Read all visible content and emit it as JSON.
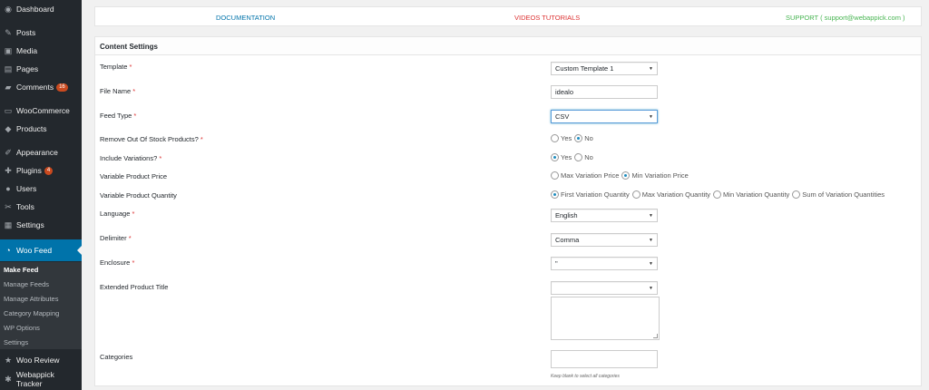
{
  "sidebar": {
    "items": [
      {
        "label": "Dashboard",
        "icon": "dashboard-icon",
        "glyph": "◉"
      },
      {
        "label": "Posts",
        "icon": "pin-icon",
        "glyph": "✎"
      },
      {
        "label": "Media",
        "icon": "media-icon",
        "glyph": "▣"
      },
      {
        "label": "Pages",
        "icon": "pages-icon",
        "glyph": "▤"
      },
      {
        "label": "Comments",
        "icon": "comments-icon",
        "glyph": "▰",
        "badge": "16"
      },
      {
        "label": "WooCommerce",
        "icon": "woocommerce-icon",
        "glyph": "▭"
      },
      {
        "label": "Products",
        "icon": "products-icon",
        "glyph": "◆"
      },
      {
        "label": "Appearance",
        "icon": "appearance-icon",
        "glyph": "✐"
      },
      {
        "label": "Plugins",
        "icon": "plugins-icon",
        "glyph": "✚",
        "badge": "4"
      },
      {
        "label": "Users",
        "icon": "users-icon",
        "glyph": "●"
      },
      {
        "label": "Tools",
        "icon": "tools-icon",
        "glyph": "✂"
      },
      {
        "label": "Settings",
        "icon": "settings-icon",
        "glyph": "▦"
      },
      {
        "label": "Woo Feed",
        "icon": "rss-icon",
        "glyph": "◔"
      },
      {
        "label": "Woo Review",
        "icon": "star-icon",
        "glyph": "★"
      },
      {
        "label": "Webappick Tracker",
        "icon": "gear-icon",
        "glyph": "✱"
      }
    ],
    "submenu": [
      "Make Feed",
      "Manage Feeds",
      "Manage Attributes",
      "Category Mapping",
      "WP Options",
      "Settings"
    ]
  },
  "top_links": {
    "documentation": "DOCUMENTATION",
    "videos": "VIDEOS TUTORIALS",
    "support": "SUPPORT ( support@webappick.com )"
  },
  "colors": {
    "sidebar_bg": "#23282d",
    "active": "#0073aa",
    "documentation": "#0073aa",
    "videos": "#dc3232",
    "support": "#46b450",
    "required": "#dc3232"
  },
  "content": {
    "title": "Content Settings",
    "required_mark": "*",
    "fields": {
      "template": {
        "label": "Template",
        "value": "Custom Template 1"
      },
      "file_name": {
        "label": "File Name",
        "value": "idealo"
      },
      "feed_type": {
        "label": "Feed Type",
        "value": "CSV"
      },
      "remove_oos": {
        "label": "Remove Out Of Stock Products?",
        "options": [
          "Yes",
          "No"
        ]
      },
      "include_variations": {
        "label": "Include Variations?",
        "options": [
          "Yes",
          "No"
        ]
      },
      "variable_price": {
        "label": "Variable Product Price",
        "options": [
          "Max Variation Price",
          "Min Variation Price"
        ]
      },
      "variable_quantity": {
        "label": "Variable Product Quantity",
        "options": [
          "First Variation Quantity",
          "Max Variation Quantity",
          "Min Variation Quantity",
          "Sum of Variation Quantities"
        ]
      },
      "language": {
        "label": "Language",
        "value": "English"
      },
      "delimiter": {
        "label": "Delimiter",
        "value": "Comma"
      },
      "enclosure": {
        "label": "Enclosure",
        "value": "\""
      },
      "extended_title": {
        "label": "Extended Product Title",
        "value": ""
      },
      "categories": {
        "label": "Categories",
        "value": "",
        "help": "Keep blank to select all categories"
      }
    }
  }
}
